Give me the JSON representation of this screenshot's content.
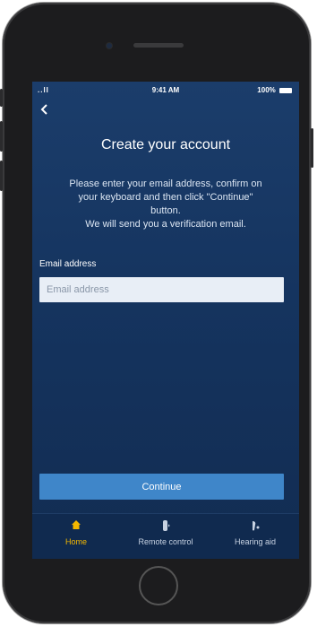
{
  "status_bar": {
    "signal": "..ll",
    "time": "9:41 AM",
    "battery": "100%"
  },
  "back_icon": "‹",
  "page": {
    "title": "Create your account",
    "instructions_line1": "Please enter your email address, confirm on",
    "instructions_line2": "your keyboard and then click \"Continue\"",
    "instructions_line3": "button.",
    "instructions_line4": "We will send you a verification email.",
    "email_label": "Email address",
    "email_placeholder": "Email address",
    "email_value": "",
    "continue_label": "Continue"
  },
  "tabs": [
    {
      "label": "Home",
      "icon": "home-icon",
      "active": true
    },
    {
      "label": "Remote control",
      "icon": "remote-icon",
      "active": false
    },
    {
      "label": "Hearing aid",
      "icon": "hearing-aid-icon",
      "active": false
    }
  ],
  "colors": {
    "background": "#15345f",
    "accent": "#3f86c9",
    "active_tab": "#f5b800"
  }
}
